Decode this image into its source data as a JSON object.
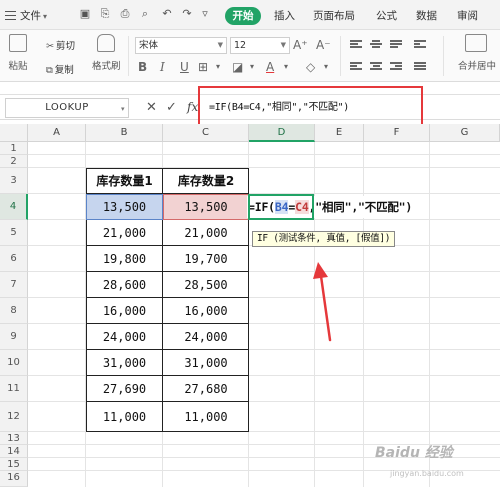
{
  "menubar": {
    "file_label": "文件",
    "tabs": [
      "开始",
      "插入",
      "页面布局",
      "公式",
      "数据",
      "审阅"
    ]
  },
  "ribbon": {
    "paste_label": "粘贴",
    "cut_label": "剪切",
    "copy_label": "复制",
    "format_painter_label": "格式刷",
    "font_name": "宋体",
    "font_size": "12",
    "merge_label": "合并居中"
  },
  "formula_bar": {
    "name_box": "LOOKUP",
    "fx_label": "fx",
    "formula": "=IF(B4=C4,\"相同\",\"不匹配\")"
  },
  "columns": [
    "A",
    "B",
    "C",
    "D",
    "E",
    "F",
    "G"
  ],
  "rows": [
    "1",
    "2",
    "3",
    "4",
    "5",
    "6",
    "7",
    "8",
    "9",
    "10",
    "11",
    "12",
    "13",
    "14",
    "15",
    "16"
  ],
  "table": {
    "headers": [
      "库存数量1",
      "库存数量2"
    ],
    "rows": [
      [
        "13,500",
        "13,500"
      ],
      [
        "21,000",
        "21,000"
      ],
      [
        "19,800",
        "19,700"
      ],
      [
        "28,600",
        "28,500"
      ],
      [
        "16,000",
        "16,000"
      ],
      [
        "24,000",
        "24,000"
      ],
      [
        "31,000",
        "31,000"
      ],
      [
        "27,690",
        "27,680"
      ],
      [
        "11,000",
        "11,000"
      ]
    ]
  },
  "editing": {
    "prefix": "=IF(",
    "ref_b": "B4",
    "op": "=",
    "ref_c": "C4",
    "suffix": ",\"相同\",\"不匹配\")"
  },
  "tooltip": "IF (测试条件, 真值, [假值])",
  "colors": {
    "accent": "#21a366",
    "highlight_red": "#e5383b",
    "ref_b": "#c6d5ee",
    "ref_c": "#f2d2d2"
  }
}
